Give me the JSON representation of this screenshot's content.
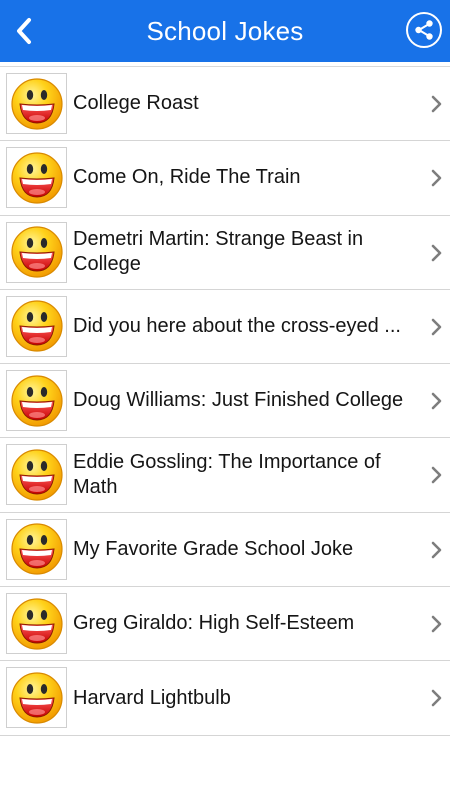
{
  "header": {
    "title": "School Jokes",
    "back_icon": "back-chevron-icon",
    "share_icon": "share-icon",
    "bar_color": "#1872e8"
  },
  "list": {
    "items": [
      {
        "label": "College Roast"
      },
      {
        "label": "Come On, Ride The Train"
      },
      {
        "label": "Demetri Martin: Strange Beast in College"
      },
      {
        "label": "Did you here about the cross-eyed ..."
      },
      {
        "label": "Doug Williams: Just Finished College"
      },
      {
        "label": "Eddie Gossling: The Importance of Math"
      },
      {
        "label": "My Favorite Grade School Joke"
      },
      {
        "label": "Greg Giraldo: High Self-Esteem"
      },
      {
        "label": "Harvard Lightbulb"
      }
    ],
    "thumbnail_icon": "smiley-face-icon",
    "row_arrow_icon": "chevron-right-icon"
  }
}
